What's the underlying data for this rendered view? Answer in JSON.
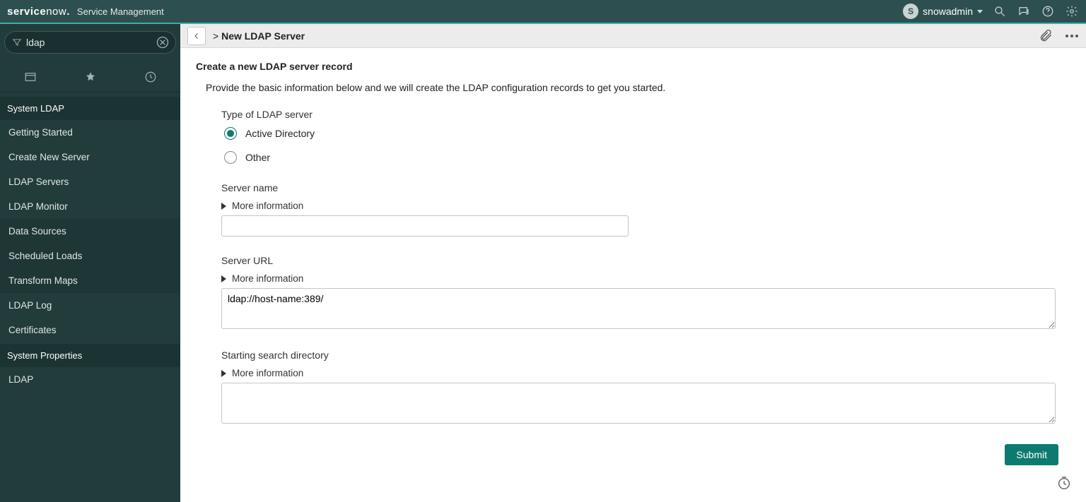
{
  "banner": {
    "brand1": "service",
    "brand2": "now",
    "subtitle": "Service Management",
    "avatar_initial": "S",
    "username": "snowadmin"
  },
  "sidebar": {
    "filter_value": "ldap",
    "group1_label": "System LDAP",
    "group1_items": [
      "Getting Started",
      "Create New Server",
      "LDAP Servers",
      "LDAP Monitor",
      "Data Sources",
      "Scheduled Loads",
      "Transform Maps",
      "LDAP Log",
      "Certificates"
    ],
    "group2_label": "System Properties",
    "group2_items": [
      "LDAP"
    ]
  },
  "header": {
    "breadcrumb_prefix": ">",
    "breadcrumb": "New LDAP Server"
  },
  "form": {
    "title": "Create a new LDAP server record",
    "intro": "Provide the basic information below and we will create the LDAP configuration records to get you started.",
    "type_label": "Type of LDAP server",
    "radio_ad": "Active Directory",
    "radio_other": "Other",
    "server_name_label": "Server name",
    "more_info": "More information",
    "server_name_value": "",
    "server_url_label": "Server URL",
    "server_url_value": "ldap://host-name:389/",
    "starting_dir_label": "Starting search directory",
    "starting_dir_value": "",
    "submit_label": "Submit"
  }
}
